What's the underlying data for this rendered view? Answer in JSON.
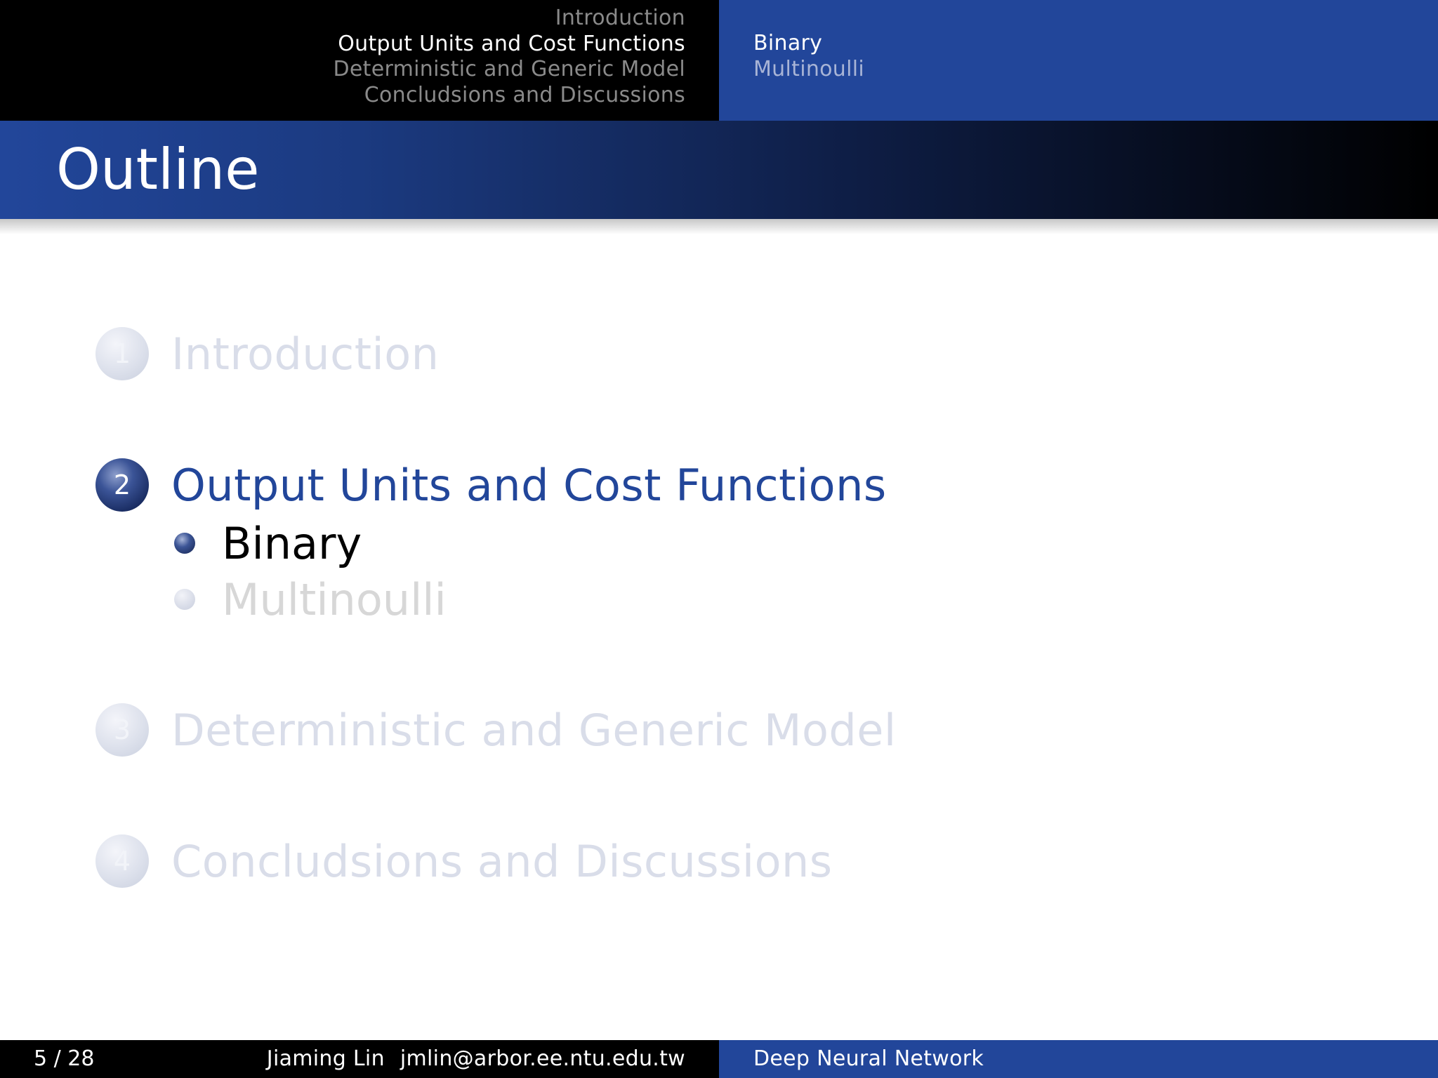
{
  "header": {
    "sections": [
      {
        "label": "Introduction",
        "active": false
      },
      {
        "label": "Output Units and Cost Functions",
        "active": true
      },
      {
        "label": "Deterministic and Generic Model",
        "active": false
      },
      {
        "label": "Concludsions and Discussions",
        "active": false
      }
    ],
    "subsections": [
      {
        "label": "Binary",
        "active": true
      },
      {
        "label": "Multinoulli",
        "active": false
      }
    ]
  },
  "frame": {
    "title": "Outline"
  },
  "outline": {
    "items": [
      {
        "number": "1",
        "label": "Introduction",
        "active": false
      },
      {
        "number": "2",
        "label": "Output Units and Cost Functions",
        "active": true,
        "subitems": [
          {
            "label": "Binary",
            "active": true
          },
          {
            "label": "Multinoulli",
            "active": false
          }
        ]
      },
      {
        "number": "3",
        "label": "Deterministic and Generic Model",
        "active": false
      },
      {
        "number": "4",
        "label": "Concludsions and Discussions",
        "active": false
      }
    ]
  },
  "footer": {
    "page": "5 / 28",
    "author": "Jiaming Lin",
    "email": "jmlin@arbor.ee.ntu.edu.tw",
    "short_title": "Deep Neural Network"
  },
  "colors": {
    "accent_blue": "#22469a",
    "header_black": "#000000",
    "inactive_text": "#d9dde9"
  }
}
